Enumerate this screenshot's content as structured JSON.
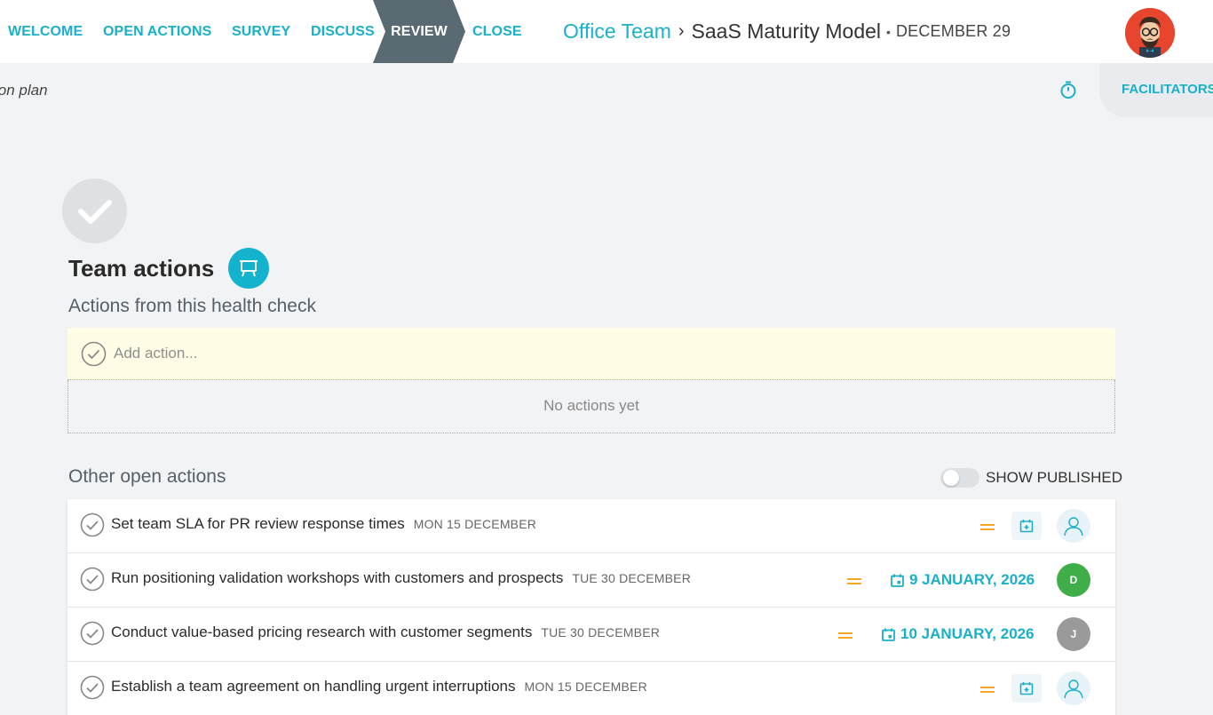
{
  "nav": {
    "steps": [
      "WELCOME",
      "OPEN ACTIONS",
      "SURVEY",
      "DISCUSS",
      "REVIEW",
      "CLOSE"
    ],
    "active_step": "REVIEW"
  },
  "breadcrumb": {
    "team": "Office Team",
    "separator": "›",
    "model": "SaaS Maturity Model",
    "dot": "•",
    "date": "DECEMBER 29"
  },
  "subbar": {
    "subtitle": "ion plan",
    "facilitators_label": "FACILITATORS"
  },
  "team_actions": {
    "title": "Team actions",
    "subtitle": "Actions from this health check",
    "add_placeholder": "Add action...",
    "empty_text": "No actions yet"
  },
  "other_actions": {
    "title": "Other open actions",
    "show_published_label": "SHOW PUBLISHED",
    "show_published": false,
    "items": [
      {
        "title": "Set team SLA for PR review response times",
        "when": "MON 15 DECEMBER",
        "due": "",
        "assignee": ""
      },
      {
        "title": "Run positioning validation workshops with customers and prospects",
        "when": "TUE 30 DECEMBER",
        "due": "9 JANUARY, 2026",
        "assignee": "D"
      },
      {
        "title": "Conduct value-based pricing research with customer segments",
        "when": "TUE 30 DECEMBER",
        "due": "10 JANUARY, 2026",
        "assignee": "J"
      },
      {
        "title": "Establish a team agreement on handling urgent interruptions",
        "when": "MON 15 DECEMBER",
        "due": "",
        "assignee": ""
      }
    ]
  },
  "colors": {
    "accent": "#1ab0c9",
    "priority": "#f5a623",
    "review_step": "#5a6a73",
    "add_row_bg": "#fffde6",
    "assignee_d": "#3fae49",
    "assignee_j": "#9a9a9a"
  },
  "icons": {
    "timer": "timer-icon",
    "present": "presentation-icon",
    "check": "check-circle-icon",
    "calendar": "calendar-add-icon",
    "user": "user-icon"
  }
}
